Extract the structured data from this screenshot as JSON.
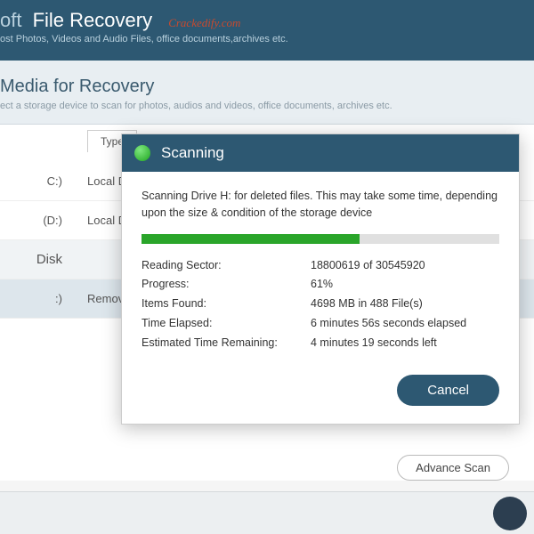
{
  "header": {
    "title_prefix": "oft",
    "title_main": "File Recovery",
    "watermark": "Crackedify.com",
    "subtitle": "ost Photos, Videos and Audio Files, office documents,archives etc."
  },
  "section": {
    "title": "Media for Recovery",
    "desc": "ect a storage device to scan for photos, audios and videos, office documents, archives etc."
  },
  "type_tab": "Type",
  "drives": {
    "row1_col1": "C:)",
    "row1_col2": "Local D",
    "row2_col1": "(D:)",
    "row2_col2": "Local D",
    "group": "Disk",
    "row3_col1": ":)",
    "row3_col2": "Remov"
  },
  "dialog": {
    "title": "Scanning",
    "message": "Scanning Drive H: for deleted files. This may take some time, depending upon the size & condition of the storage device",
    "progress_pct": 61,
    "stats": {
      "reading_sector_label": "Reading Sector:",
      "reading_sector_val": "18800619 of 30545920",
      "progress_label": "Progress:",
      "progress_val": "61%",
      "items_found_label": "Items Found:",
      "items_found_val": "4698 MB in 488 File(s)",
      "time_elapsed_label": "Time Elapsed:",
      "time_elapsed_val": "6 minutes 56s seconds elapsed",
      "est_remaining_label": "Estimated Time Remaining:",
      "est_remaining_val": "4 minutes 19 seconds left"
    },
    "cancel": "Cancel"
  },
  "advance_scan": "Advance Scan"
}
